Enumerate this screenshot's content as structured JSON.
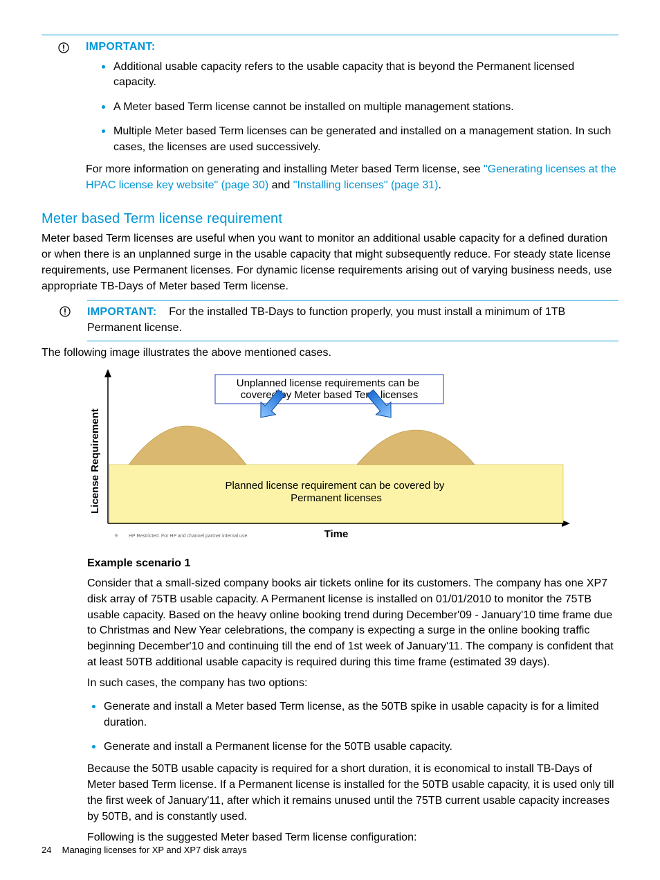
{
  "important1": {
    "label": "IMPORTANT:",
    "bullets": [
      "Additional usable capacity refers to the usable capacity that is beyond the Permanent licensed capacity.",
      "A Meter based Term license cannot be installed on multiple management stations.",
      "Multiple Meter based Term licenses can be generated and installed on a management station. In such cases, the licenses are used successively."
    ],
    "followup_pre": "For more information on generating and installing Meter based Term license, see ",
    "link1": "\"Generating licenses at the HPAC license key website\" (page 30)",
    "followup_mid": " and ",
    "link2": "\"Installing licenses\" (page 31)",
    "followup_end": "."
  },
  "section1": {
    "title": "Meter based Term license requirement",
    "para": "Meter based Term licenses are useful when you want to monitor an additional usable capacity for a defined duration or when there is an unplanned surge in the usable capacity that might subsequently reduce. For steady state license requirements, use Permanent licenses. For dynamic license requirements arising out of varying business needs, use appropriate TB-Days of Meter based Term license."
  },
  "important2": {
    "label": "IMPORTANT:",
    "text": "For the installed TB-Days to function properly, you must install a minimum of 1TB Permanent license."
  },
  "caption": "The following image illustrates the above mentioned cases.",
  "figure": {
    "y_axis": "License Requirement",
    "x_axis": "Time",
    "top_box": "Unplanned license requirements can be covered by Meter based Term licenses",
    "bottom_box": "Planned license requirement can be covered by Permanent licenses",
    "restricted": "HP Restricted. For HP and channel partner internal use.",
    "restricted_num": "9"
  },
  "example": {
    "heading": "Example scenario 1",
    "para1": "Consider that a small-sized company books air tickets online for its customers. The company has one XP7 disk array of 75TB usable capacity. A Permanent license is installed on 01/01/2010 to monitor the 75TB usable capacity. Based on the heavy online booking trend during December'09 - January'10 time frame due to Christmas and New Year celebrations, the company is expecting a surge in the online booking traffic beginning December'10 and continuing till the end of 1st week of January'11. The company is confident that at least 50TB additional usable capacity is required during this time frame (estimated 39 days).",
    "para2": "In such cases, the company has two options:",
    "bullets": [
      "Generate and install a Meter based Term license, as the 50TB spike in usable capacity is for a limited duration.",
      "Generate and install a Permanent license for the 50TB usable capacity."
    ],
    "para3": "Because the 50TB usable capacity is required for a short duration, it is economical to install TB-Days of Meter based Term license. If a Permanent license is installed for the 50TB usable capacity, it is used only till the first week of January'11, after which it remains unused until the 75TB current usable capacity increases by 50TB, and is constantly used.",
    "para4": "Following is the suggested Meter based Term license configuration:"
  },
  "footer": {
    "page": "24",
    "title": "Managing licenses for XP and XP7 disk arrays"
  }
}
